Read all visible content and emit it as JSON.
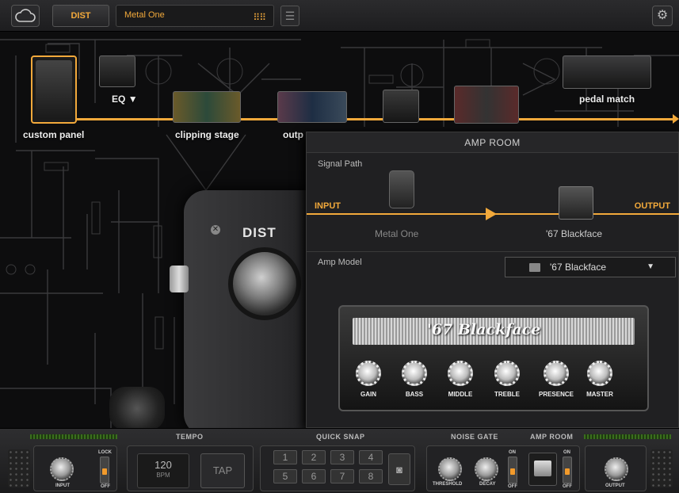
{
  "topbar": {
    "pedal_tab": "DIST",
    "preset_name": "Metal One"
  },
  "chain": {
    "custom_panel": "custom panel",
    "eq": "EQ",
    "clipping_stage": "clipping stage",
    "output": "outp",
    "pedal_match": "pedal match"
  },
  "pedal": {
    "label": "DIST"
  },
  "amp_room": {
    "title": "AMP ROOM",
    "signal_path_label": "Signal Path",
    "input_label": "INPUT",
    "output_label": "OUTPUT",
    "pedal_name": "Metal One",
    "amp_name": "'67 Blackface",
    "amp_model_label": "Amp Model",
    "amp_model_value": "'67 Blackface",
    "amp_display_name": "'67 Blackface",
    "knobs": [
      "GAIN",
      "BASS",
      "MIDDLE",
      "TREBLE",
      "PRESENCE",
      "MASTER"
    ]
  },
  "bottom": {
    "tempo_title": "TEMPO",
    "quick_snap_title": "QUICK SNAP",
    "noise_gate_title": "NOISE GATE",
    "amp_room_title": "AMP ROOM",
    "input_label": "INPUT",
    "lock_label": "LOCK",
    "off_label": "OFF",
    "on_label": "ON",
    "bpm_value": "120",
    "bpm_unit": "BPM",
    "tap_label": "TAP",
    "snaps": [
      "1",
      "2",
      "3",
      "4",
      "5",
      "6",
      "7",
      "8"
    ],
    "threshold_label": "THRESHOLD",
    "decay_label": "DECAY",
    "output_label": "OUTPUT"
  }
}
